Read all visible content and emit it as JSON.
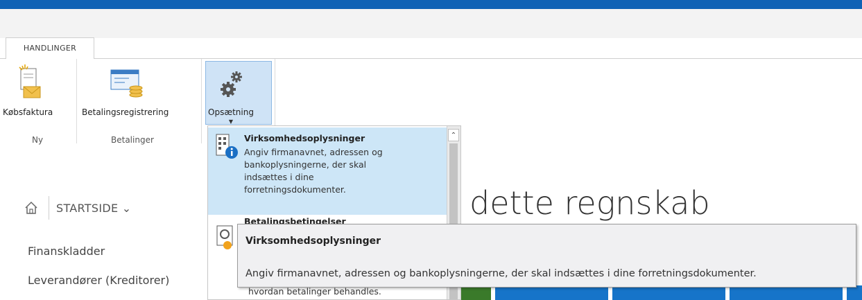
{
  "ribbon": {
    "tab_label": "HANDLINGER",
    "buttons": {
      "koebsfaktura": "Købsfaktura",
      "betalingsregistrering": "Betalingsregistrering",
      "opsaetning": "Opsætning"
    },
    "groups": {
      "ny": "Ny",
      "betalinger": "Betalinger"
    }
  },
  "breadcrumb": {
    "label": "STARTSIDE ⌄"
  },
  "nav": {
    "items": [
      "Finanskladder",
      "Leverandører (Kreditorer)"
    ]
  },
  "page": {
    "title_fragment": "dette regnskab"
  },
  "dropdown": {
    "items": [
      {
        "title": "Virksomhedsoplysninger",
        "desc_lines": [
          "Angiv firmanavnet, adressen og",
          "bankoplysningerne, der skal",
          "indsættes i dine",
          "forretningsdokumenter."
        ]
      },
      {
        "title": "Betalingsbetingelser",
        "desc_last_line": "hvordan betalinger behandles."
      }
    ]
  },
  "tooltip": {
    "title": "Virksomhedsoplysninger",
    "desc": "Angiv firmanavnet, adressen og bankoplysningerne, der skal indsættes i dine forretningsdokumenter."
  },
  "colors": {
    "top_bar": "#0f62b5",
    "selected_item": "#cde6f7",
    "tile_green": "#3a7a2a",
    "tile_blue": "#1674c9"
  },
  "icons": {
    "koebsfaktura": "purchase-invoice-icon",
    "betalingsregistrering": "payment-registration-icon",
    "opsaetning": "gears-icon",
    "home": "home-icon",
    "company_info": "company-info-icon",
    "payment_terms": "payment-terms-icon"
  }
}
